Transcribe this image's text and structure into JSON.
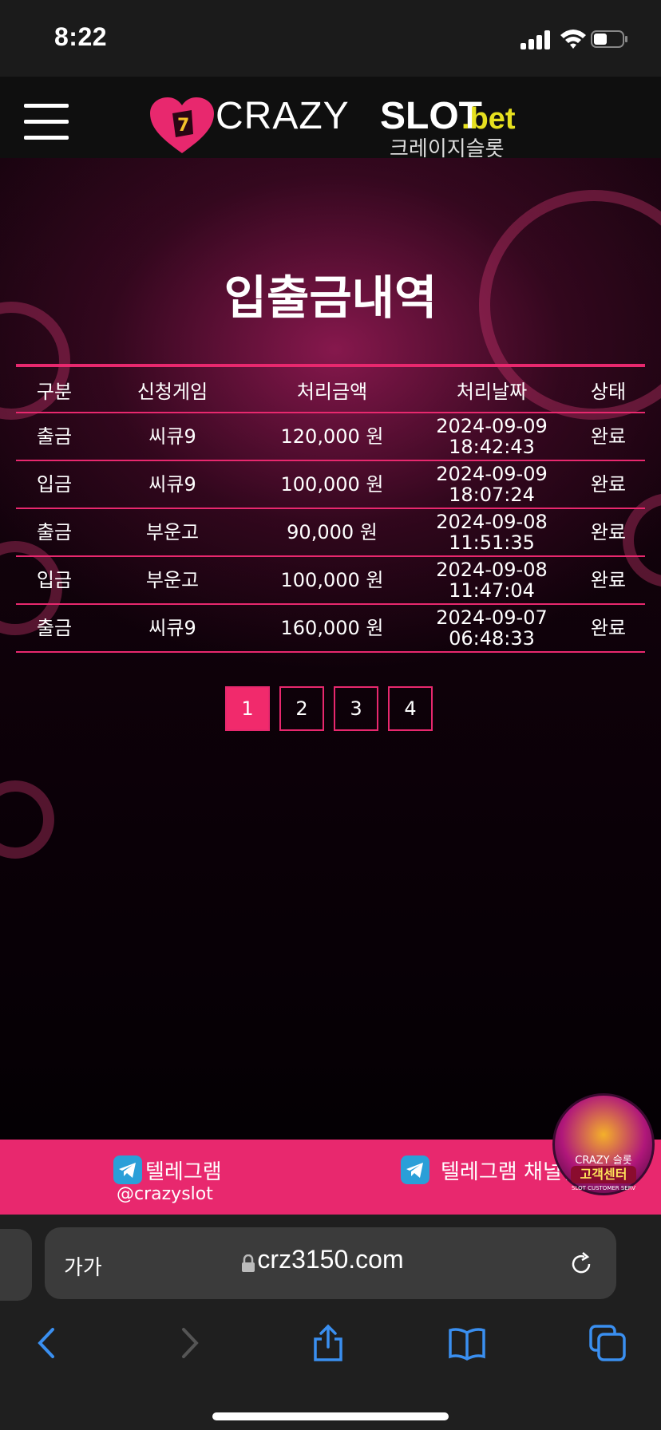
{
  "status_bar": {
    "time": "8:22"
  },
  "header": {
    "logo_crazy": "CRAZY",
    "logo_slot": "SLOT",
    "logo_bet": ".bet",
    "logo_korean": "크레이지슬롯"
  },
  "page": {
    "title": "입출금내역"
  },
  "table": {
    "headers": [
      "구분",
      "신청게임",
      "처리금액",
      "처리날짜",
      "상태"
    ],
    "rows": [
      {
        "type": "출금",
        "game": "씨큐9",
        "amount": "120,000 원",
        "date": "2024-09-09",
        "time": "18:42:43",
        "status": "완료"
      },
      {
        "type": "입금",
        "game": "씨큐9",
        "amount": "100,000 원",
        "date": "2024-09-09",
        "time": "18:07:24",
        "status": "완료"
      },
      {
        "type": "출금",
        "game": "부운고",
        "amount": "90,000 원",
        "date": "2024-09-08",
        "time": "11:51:35",
        "status": "완료"
      },
      {
        "type": "입금",
        "game": "부운고",
        "amount": "100,000 원",
        "date": "2024-09-08",
        "time": "11:47:04",
        "status": "완료"
      },
      {
        "type": "출금",
        "game": "씨큐9",
        "amount": "160,000 원",
        "date": "2024-09-07",
        "time": "06:48:33",
        "status": "완료"
      }
    ]
  },
  "pagination": {
    "pages": [
      "1",
      "2",
      "3",
      "4"
    ],
    "active": "1"
  },
  "contact": {
    "telegram_label": "텔레그램",
    "telegram_handle": "@crazyslot",
    "telegram_channel_label": "텔레그램 채널입"
  },
  "cs_badge": {
    "brand": "CRAZY 슬롯",
    "label": "고객센터",
    "sub": "SLOT CUSTOMER SERV"
  },
  "browser": {
    "text_size_label": "가가",
    "url": "crz3150.com"
  },
  "colors": {
    "accent": "#e8286e",
    "active_page": "#f12a6c",
    "logo_bet": "#e6e01f"
  }
}
